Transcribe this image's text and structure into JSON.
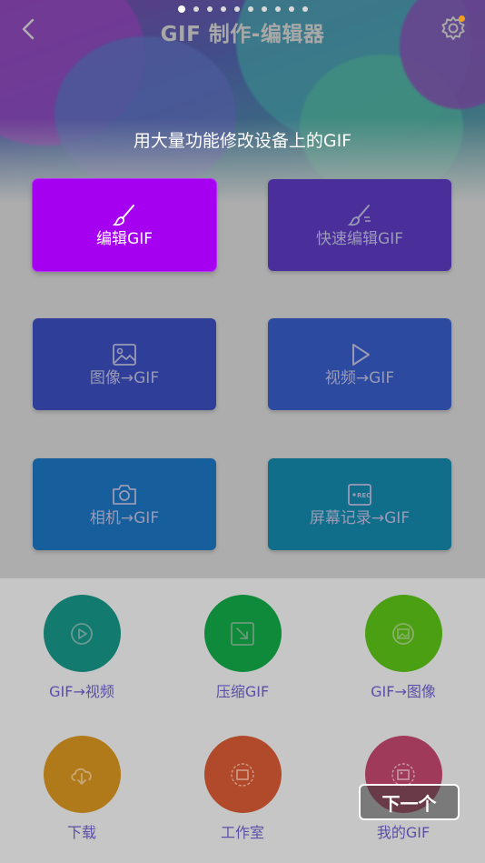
{
  "header": {
    "title": "GIF 制作-编辑器",
    "pager_dots": 10,
    "active_dot": 0
  },
  "tagline": "用大量功能修改设备上的GIF",
  "cards": [
    {
      "label": "编辑GIF",
      "icon": "brush-icon",
      "color": "#a600f0",
      "highlighted": true
    },
    {
      "label": "快速编辑GIF",
      "icon": "quick-brush-icon",
      "color": "#4a2f9a"
    },
    {
      "label": "图像→GIF",
      "icon": "image-icon",
      "color": "#2f3e98"
    },
    {
      "label": "视频→GIF",
      "icon": "play-icon",
      "color": "#2c4aa0"
    },
    {
      "label": "相机→GIF",
      "icon": "camera-icon",
      "color": "#175f9c"
    },
    {
      "label": "屏幕记录→GIF",
      "icon": "rec-icon",
      "color": "#116e8a"
    }
  ],
  "circles": [
    {
      "label": "GIF→视频",
      "icon": "video-convert-icon",
      "color": "#127a6e"
    },
    {
      "label": "压缩GIF",
      "icon": "compress-icon",
      "color": "#0f8a3a"
    },
    {
      "label": "GIF→图像",
      "icon": "image-convert-icon",
      "color": "#4aa012"
    },
    {
      "label": "下载",
      "icon": "cloud-download-icon",
      "color": "#b07a1a"
    },
    {
      "label": "工作室",
      "icon": "studio-icon",
      "color": "#b04a2a"
    },
    {
      "label": "我的GIF",
      "icon": "my-gif-icon",
      "color": "#a03a5a"
    }
  ],
  "next_button": "下一个"
}
